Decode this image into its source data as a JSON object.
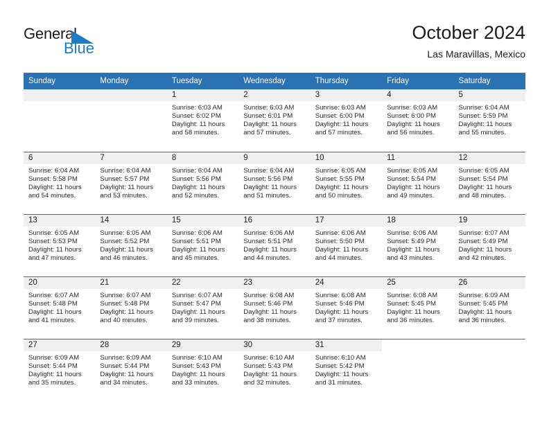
{
  "brand": {
    "name_part1": "General",
    "name_part2": "Blue",
    "flag_icon": "blue-triangle-flag-icon",
    "accent_color": "#1f7ac4"
  },
  "header": {
    "title": "October 2024",
    "subtitle": "Las Maravillas, Mexico"
  },
  "theme": {
    "header_blue": "#2b72b4",
    "daynum_bg": "#f0f0f0",
    "text": "#1c1c1c"
  },
  "calendar": {
    "weekday_headers": [
      "Sunday",
      "Monday",
      "Tuesday",
      "Wednesday",
      "Thursday",
      "Friday",
      "Saturday"
    ],
    "labels": {
      "sunrise": "Sunrise:",
      "sunset": "Sunset:",
      "daylight": "Daylight:"
    },
    "weeks": [
      [
        {
          "empty": true
        },
        {
          "empty": true
        },
        {
          "day": "1",
          "sunrise": "Sunrise: 6:03 AM",
          "sunset": "Sunset: 6:02 PM",
          "daylight": "Daylight: 11 hours and 58 minutes."
        },
        {
          "day": "2",
          "sunrise": "Sunrise: 6:03 AM",
          "sunset": "Sunset: 6:01 PM",
          "daylight": "Daylight: 11 hours and 57 minutes."
        },
        {
          "day": "3",
          "sunrise": "Sunrise: 6:03 AM",
          "sunset": "Sunset: 6:00 PM",
          "daylight": "Daylight: 11 hours and 57 minutes."
        },
        {
          "day": "4",
          "sunrise": "Sunrise: 6:03 AM",
          "sunset": "Sunset: 6:00 PM",
          "daylight": "Daylight: 11 hours and 56 minutes."
        },
        {
          "day": "5",
          "sunrise": "Sunrise: 6:04 AM",
          "sunset": "Sunset: 5:59 PM",
          "daylight": "Daylight: 11 hours and 55 minutes."
        }
      ],
      [
        {
          "day": "6",
          "sunrise": "Sunrise: 6:04 AM",
          "sunset": "Sunset: 5:58 PM",
          "daylight": "Daylight: 11 hours and 54 minutes."
        },
        {
          "day": "7",
          "sunrise": "Sunrise: 6:04 AM",
          "sunset": "Sunset: 5:57 PM",
          "daylight": "Daylight: 11 hours and 53 minutes."
        },
        {
          "day": "8",
          "sunrise": "Sunrise: 6:04 AM",
          "sunset": "Sunset: 5:56 PM",
          "daylight": "Daylight: 11 hours and 52 minutes."
        },
        {
          "day": "9",
          "sunrise": "Sunrise: 6:04 AM",
          "sunset": "Sunset: 5:56 PM",
          "daylight": "Daylight: 11 hours and 51 minutes."
        },
        {
          "day": "10",
          "sunrise": "Sunrise: 6:05 AM",
          "sunset": "Sunset: 5:55 PM",
          "daylight": "Daylight: 11 hours and 50 minutes."
        },
        {
          "day": "11",
          "sunrise": "Sunrise: 6:05 AM",
          "sunset": "Sunset: 5:54 PM",
          "daylight": "Daylight: 11 hours and 49 minutes."
        },
        {
          "day": "12",
          "sunrise": "Sunrise: 6:05 AM",
          "sunset": "Sunset: 5:54 PM",
          "daylight": "Daylight: 11 hours and 48 minutes."
        }
      ],
      [
        {
          "day": "13",
          "sunrise": "Sunrise: 6:05 AM",
          "sunset": "Sunset: 5:53 PM",
          "daylight": "Daylight: 11 hours and 47 minutes."
        },
        {
          "day": "14",
          "sunrise": "Sunrise: 6:05 AM",
          "sunset": "Sunset: 5:52 PM",
          "daylight": "Daylight: 11 hours and 46 minutes."
        },
        {
          "day": "15",
          "sunrise": "Sunrise: 6:06 AM",
          "sunset": "Sunset: 5:51 PM",
          "daylight": "Daylight: 11 hours and 45 minutes."
        },
        {
          "day": "16",
          "sunrise": "Sunrise: 6:06 AM",
          "sunset": "Sunset: 5:51 PM",
          "daylight": "Daylight: 11 hours and 44 minutes."
        },
        {
          "day": "17",
          "sunrise": "Sunrise: 6:06 AM",
          "sunset": "Sunset: 5:50 PM",
          "daylight": "Daylight: 11 hours and 44 minutes."
        },
        {
          "day": "18",
          "sunrise": "Sunrise: 6:06 AM",
          "sunset": "Sunset: 5:49 PM",
          "daylight": "Daylight: 11 hours and 43 minutes."
        },
        {
          "day": "19",
          "sunrise": "Sunrise: 6:07 AM",
          "sunset": "Sunset: 5:49 PM",
          "daylight": "Daylight: 11 hours and 42 minutes."
        }
      ],
      [
        {
          "day": "20",
          "sunrise": "Sunrise: 6:07 AM",
          "sunset": "Sunset: 5:48 PM",
          "daylight": "Daylight: 11 hours and 41 minutes."
        },
        {
          "day": "21",
          "sunrise": "Sunrise: 6:07 AM",
          "sunset": "Sunset: 5:48 PM",
          "daylight": "Daylight: 11 hours and 40 minutes."
        },
        {
          "day": "22",
          "sunrise": "Sunrise: 6:07 AM",
          "sunset": "Sunset: 5:47 PM",
          "daylight": "Daylight: 11 hours and 39 minutes."
        },
        {
          "day": "23",
          "sunrise": "Sunrise: 6:08 AM",
          "sunset": "Sunset: 5:46 PM",
          "daylight": "Daylight: 11 hours and 38 minutes."
        },
        {
          "day": "24",
          "sunrise": "Sunrise: 6:08 AM",
          "sunset": "Sunset: 5:46 PM",
          "daylight": "Daylight: 11 hours and 37 minutes."
        },
        {
          "day": "25",
          "sunrise": "Sunrise: 6:08 AM",
          "sunset": "Sunset: 5:45 PM",
          "daylight": "Daylight: 11 hours and 36 minutes."
        },
        {
          "day": "26",
          "sunrise": "Sunrise: 6:09 AM",
          "sunset": "Sunset: 5:45 PM",
          "daylight": "Daylight: 11 hours and 36 minutes."
        }
      ],
      [
        {
          "day": "27",
          "sunrise": "Sunrise: 6:09 AM",
          "sunset": "Sunset: 5:44 PM",
          "daylight": "Daylight: 11 hours and 35 minutes."
        },
        {
          "day": "28",
          "sunrise": "Sunrise: 6:09 AM",
          "sunset": "Sunset: 5:44 PM",
          "daylight": "Daylight: 11 hours and 34 minutes."
        },
        {
          "day": "29",
          "sunrise": "Sunrise: 6:10 AM",
          "sunset": "Sunset: 5:43 PM",
          "daylight": "Daylight: 11 hours and 33 minutes."
        },
        {
          "day": "30",
          "sunrise": "Sunrise: 6:10 AM",
          "sunset": "Sunset: 5:43 PM",
          "daylight": "Daylight: 11 hours and 32 minutes."
        },
        {
          "day": "31",
          "sunrise": "Sunrise: 6:10 AM",
          "sunset": "Sunset: 5:42 PM",
          "daylight": "Daylight: 11 hours and 31 minutes."
        },
        {
          "empty": true
        },
        {
          "empty": true
        }
      ]
    ]
  }
}
